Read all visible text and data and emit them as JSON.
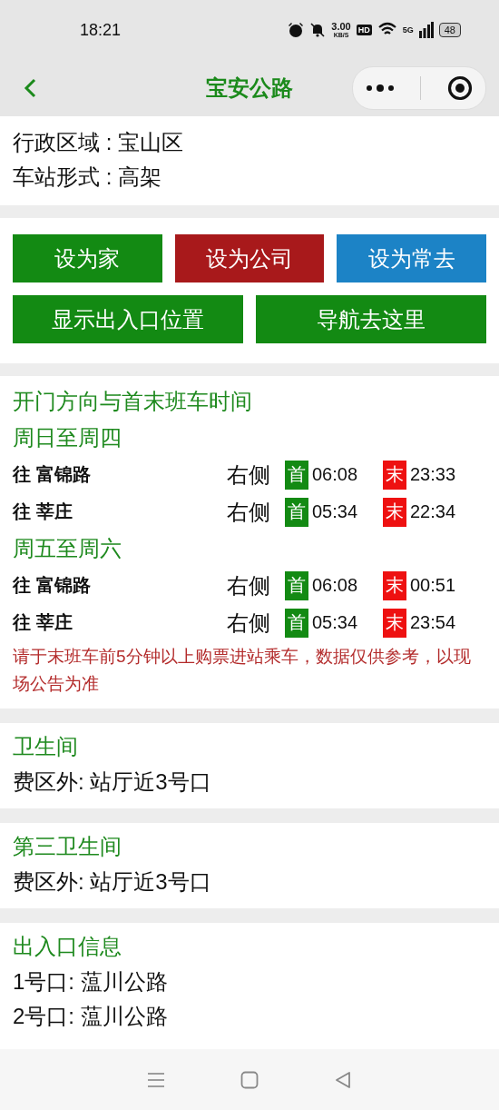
{
  "status_bar": {
    "time": "18:21",
    "net_speed": "3.00",
    "net_unit": "KB/S",
    "hd": "HD",
    "network": "5G",
    "battery": "48"
  },
  "header": {
    "title": "宝安公路"
  },
  "station_info": [
    "行政区域 : 宝山区",
    "车站形式 : 高架"
  ],
  "actions": [
    {
      "label": "设为家",
      "color": "#138a13"
    },
    {
      "label": "设为公司",
      "color": "#a8191b"
    },
    {
      "label": "设为常去",
      "color": "#1c83c6"
    },
    {
      "label": "显示出入口位置",
      "color": "#138a13"
    },
    {
      "label": "导航去这里",
      "color": "#138a13"
    }
  ],
  "timetable": {
    "title": "开门方向与首末班车时间",
    "groups": [
      {
        "days": "周日至周四",
        "rows": [
          {
            "direction": "往 富锦路",
            "door": "右侧",
            "first_label": "首",
            "first": "06:08",
            "last_label": "末",
            "last": "23:33"
          },
          {
            "direction": "往 莘庄",
            "door": "右侧",
            "first_label": "首",
            "first": "05:34",
            "last_label": "末",
            "last": "22:34"
          }
        ]
      },
      {
        "days": "周五至周六",
        "rows": [
          {
            "direction": "往 富锦路",
            "door": "右侧",
            "first_label": "首",
            "first": "06:08",
            "last_label": "末",
            "last": "00:51"
          },
          {
            "direction": "往 莘庄",
            "door": "右侧",
            "first_label": "首",
            "first": "05:34",
            "last_label": "末",
            "last": "23:54"
          }
        ]
      }
    ],
    "notice": "请于末班车前5分钟以上购票进站乘车，数据仅供参考，以现场公告为准"
  },
  "facilities": [
    {
      "title": "卫生间",
      "text": "费区外: 站厅近3号口"
    },
    {
      "title": "第三卫生间",
      "text": "费区外: 站厅近3号口"
    }
  ],
  "exits": {
    "title": "出入口信息",
    "items": [
      "1号口: 蕰川公路",
      "2号口: 蕰川公路"
    ]
  }
}
